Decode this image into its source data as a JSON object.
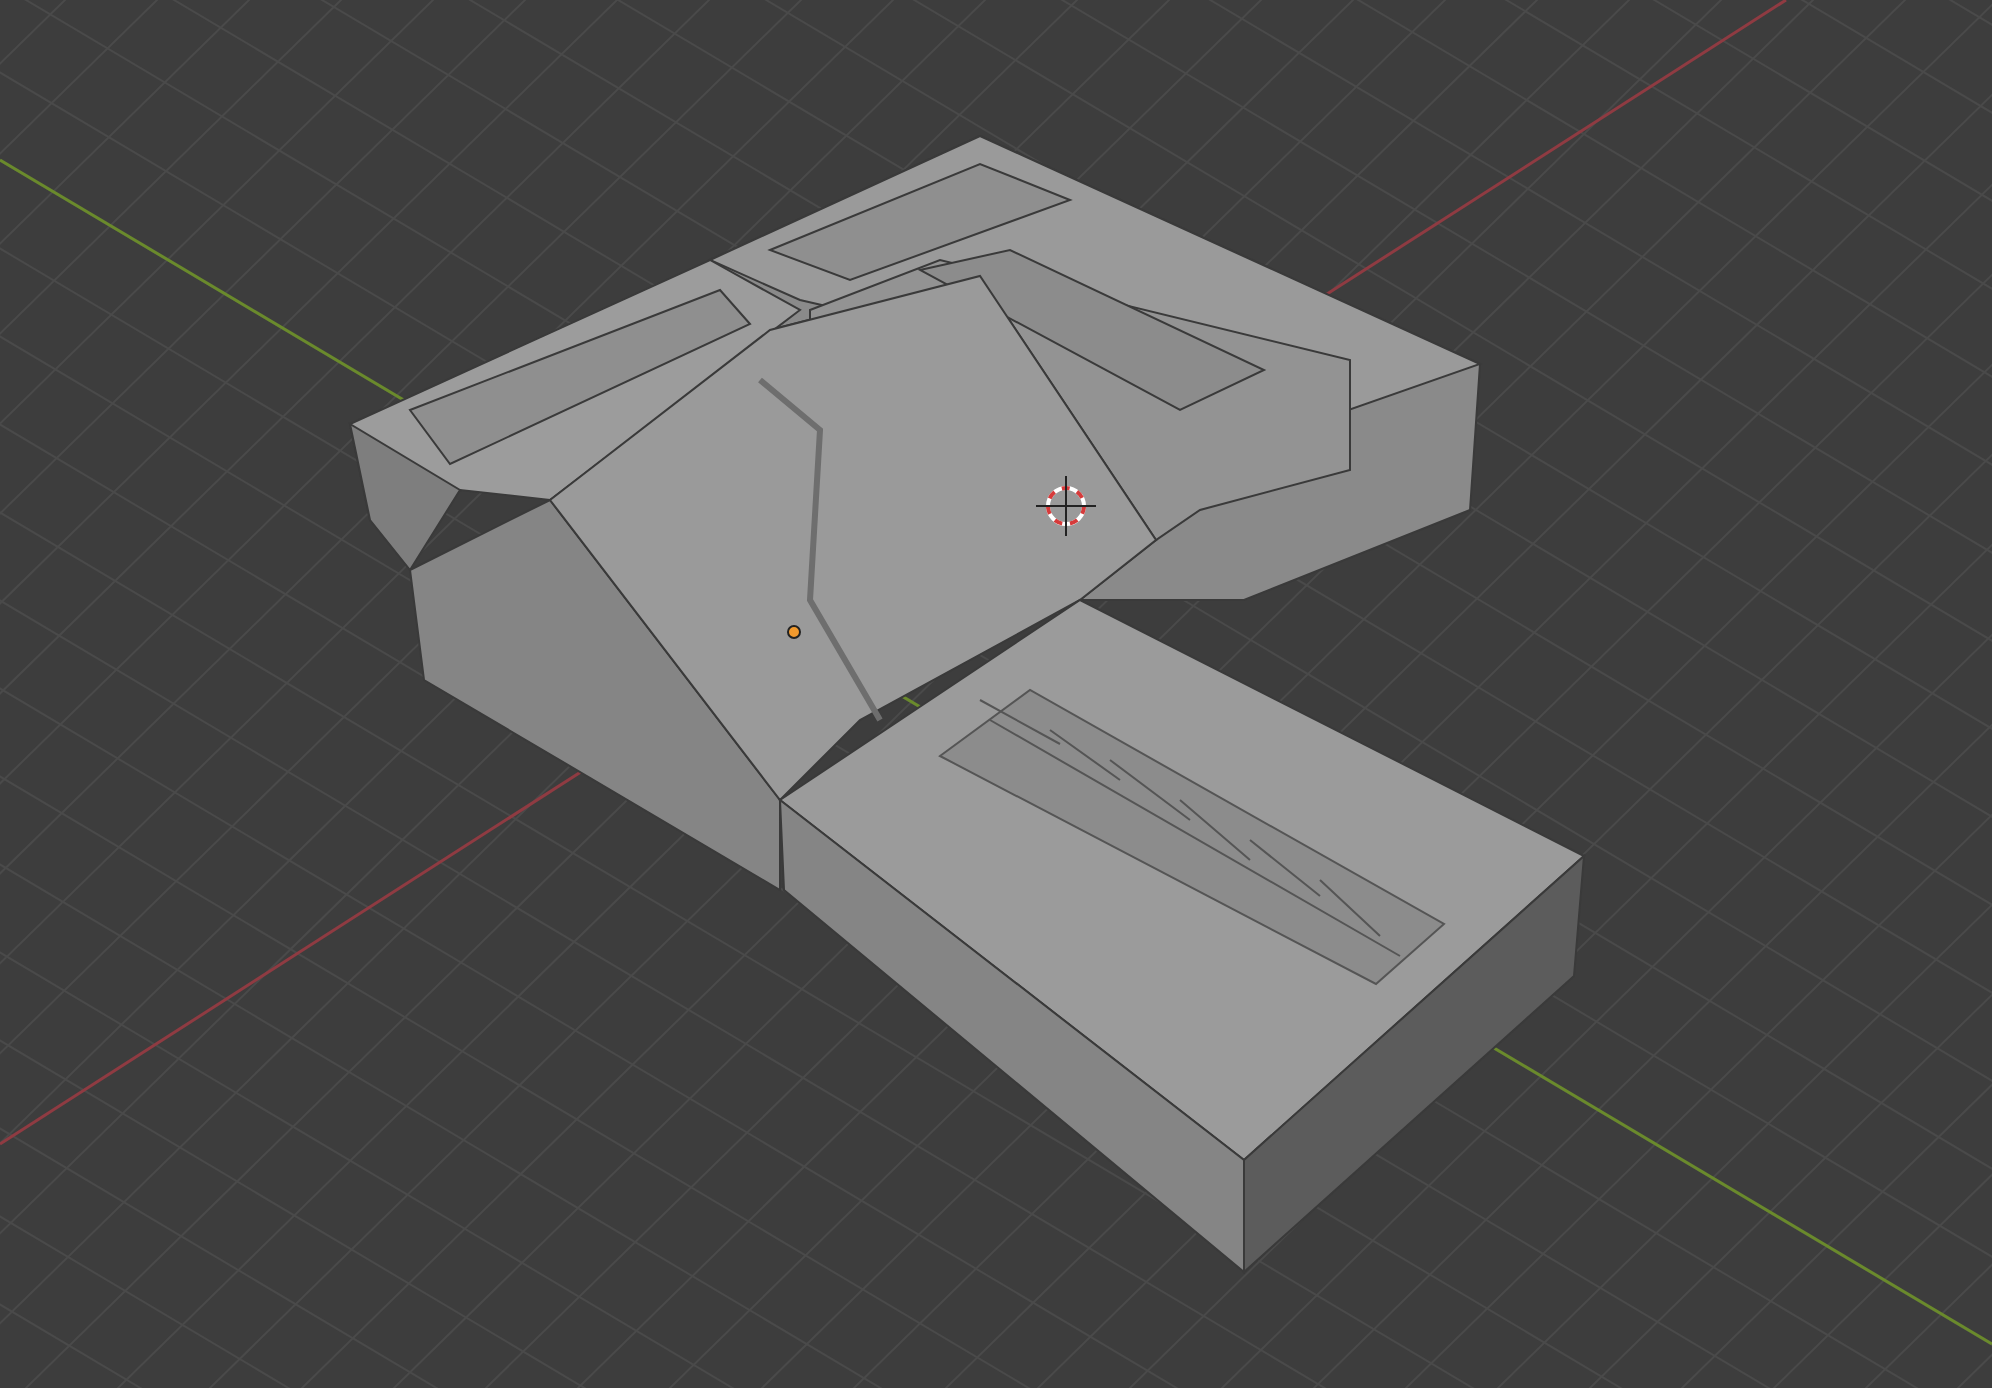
{
  "viewport": {
    "axes": [
      {
        "kind": "x",
        "color": "#8f3b42"
      },
      {
        "kind": "y",
        "color": "#6a8a2c"
      }
    ]
  }
}
